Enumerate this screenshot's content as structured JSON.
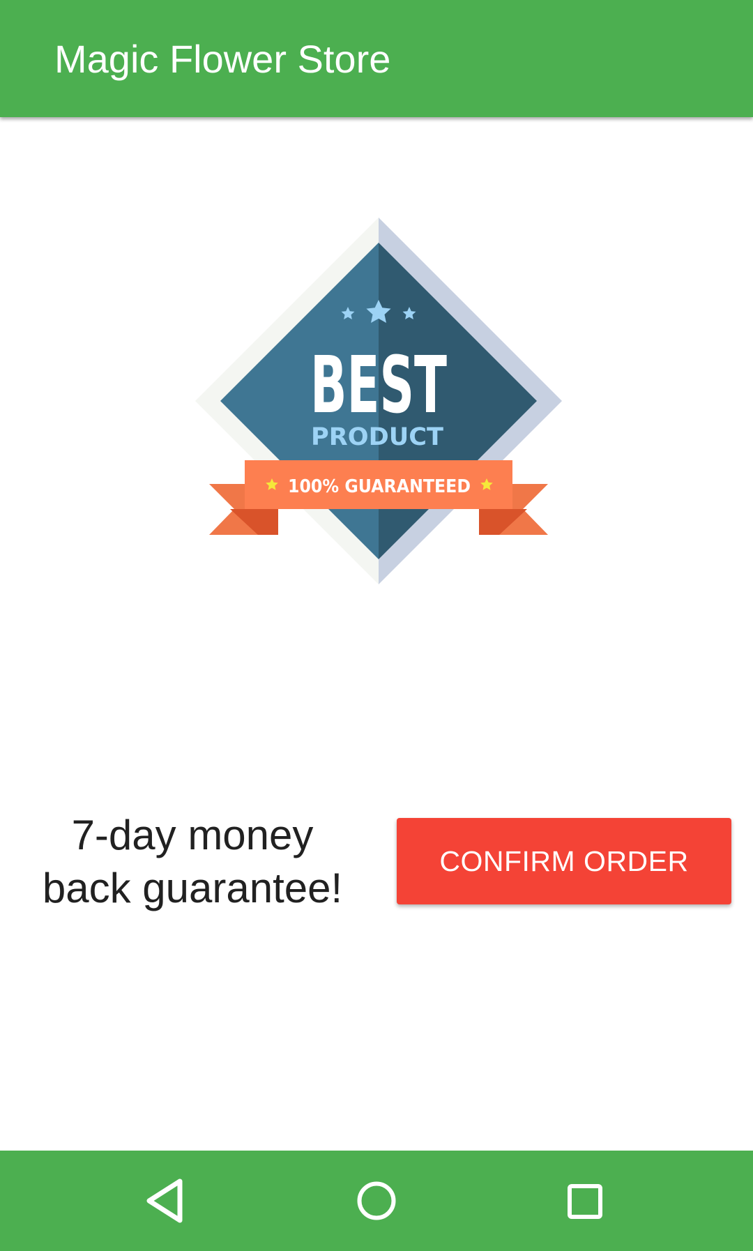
{
  "app_bar": {
    "title": "Magic Flower Store",
    "background_color": "#4caf50"
  },
  "badge": {
    "main_text": "BEST",
    "sub_text": "PRODUCT",
    "ribbon_text": "100% GUARANTEED",
    "colors": {
      "diamond_left": "#3f7693",
      "diamond_right": "#305a70",
      "border_left": "#f4f6f2",
      "border_right": "#c7d0e1",
      "ribbon": "#fd7f50",
      "ribbon_tail": "#f07748",
      "ribbon_fold": "#d9532a",
      "stars_top": "#9dd3f5",
      "stars_ribbon": "#f5e83a"
    }
  },
  "content": {
    "guarantee_line1": "7-day money",
    "guarantee_line2": "back guarantee!",
    "confirm_button_label": "CONFIRM ORDER",
    "confirm_button_color": "#f44336"
  },
  "nav_bar": {
    "background_color": "#4caf50",
    "buttons": [
      {
        "name": "back",
        "icon": "back-triangle-icon"
      },
      {
        "name": "home",
        "icon": "home-circle-icon"
      },
      {
        "name": "recents",
        "icon": "recents-square-icon"
      }
    ]
  }
}
